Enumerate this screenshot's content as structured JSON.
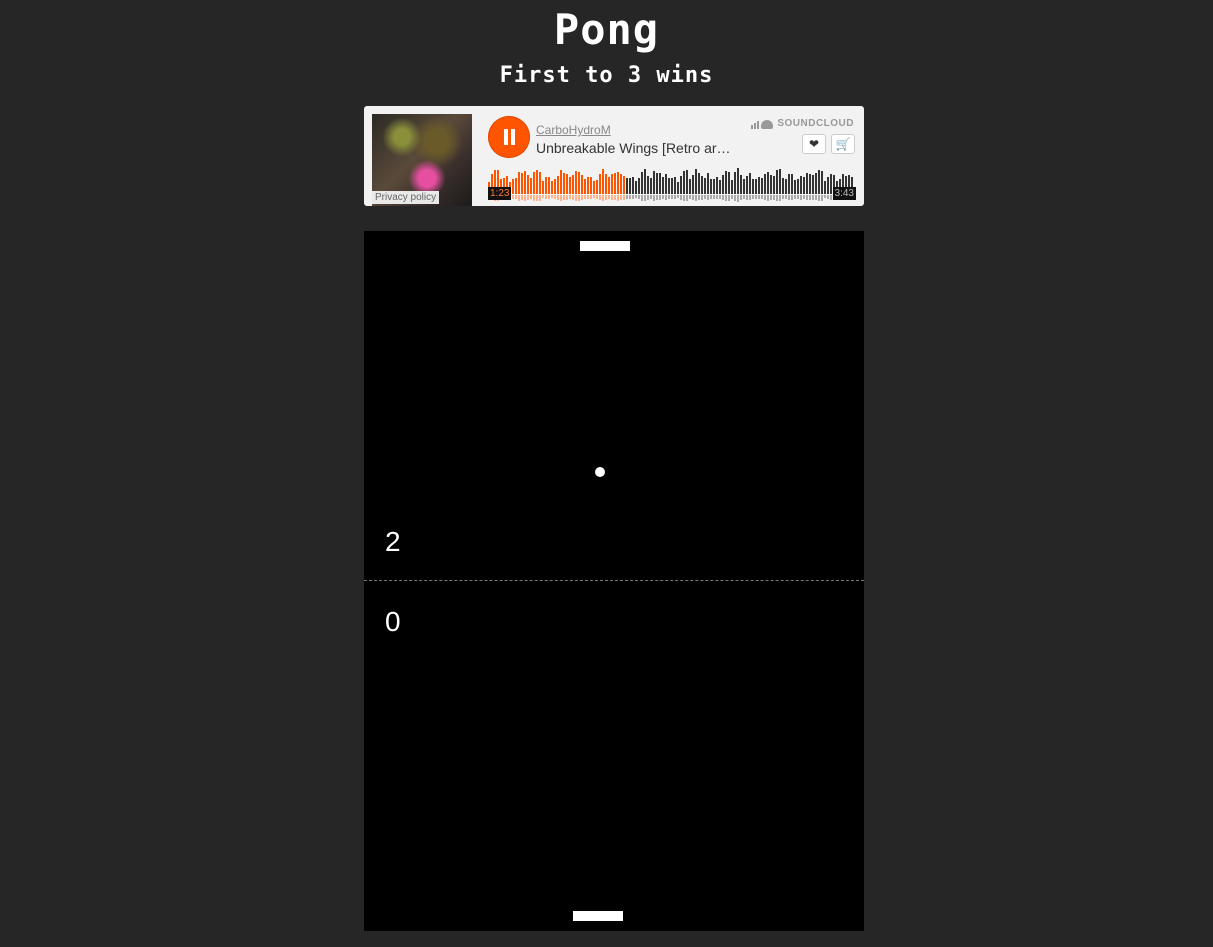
{
  "header": {
    "title": "Pong",
    "subtitle": "First to 3 wins"
  },
  "player": {
    "artist": "CarboHydroM",
    "track_title": "Unbreakable Wings [Retro ar…",
    "brand": "SOUNDCLOUD",
    "privacy_label": "Privacy policy",
    "current_time": "1:23",
    "total_time": "3:43",
    "progress": 0.37,
    "state": "playing",
    "accent_color": "#ff5500",
    "icons": {
      "pause": "pause-icon",
      "like": "heart-icon",
      "buy": "cart-icon",
      "logo": "soundcloud-icon"
    }
  },
  "game": {
    "score_top": "2",
    "score_bottom": "0",
    "background_color": "#000000",
    "foreground_color": "#ffffff"
  }
}
